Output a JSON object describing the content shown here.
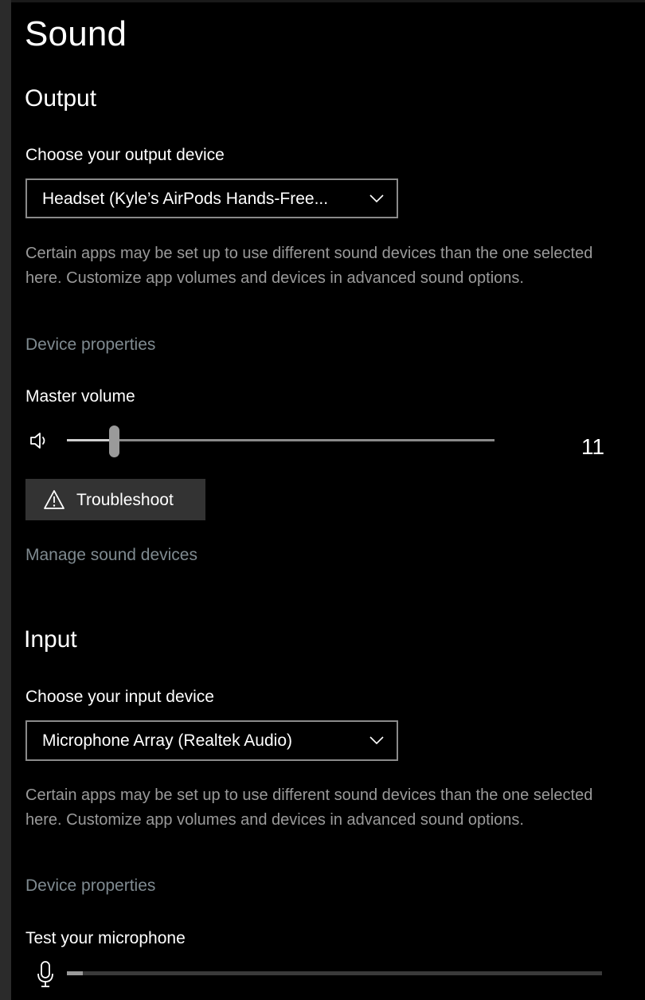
{
  "page": {
    "title": "Sound"
  },
  "output": {
    "title": "Output",
    "device_label": "Choose your output device",
    "selected_device": "Headset (Kyle’s AirPods Hands-Free...",
    "description": "Certain apps may be set up to use different sound devices than the one selected here. Customize app volumes and devices in advanced sound options.",
    "device_properties_link": "Device properties",
    "master_volume_label": "Master volume",
    "master_volume_value": "11",
    "master_volume_level": 11,
    "troubleshoot_label": "Troubleshoot",
    "manage_devices_link": "Manage sound devices"
  },
  "input": {
    "title": "Input",
    "device_label": "Choose your input device",
    "selected_device": "Microphone Array (Realtek Audio)",
    "description": "Certain apps may be set up to use different sound devices than the one selected here. Customize app volumes and devices in advanced sound options.",
    "device_properties_link": "Device properties",
    "test_label": "Test your microphone",
    "mic_level": 3
  },
  "icons": {
    "chevron": "chevron-down-icon",
    "speaker": "speaker-icon",
    "warning": "warning-icon",
    "microphone": "microphone-icon"
  },
  "colors": {
    "background": "#000000",
    "link": "#7f8a90",
    "secondary_text": "#9a9a9a",
    "button": "#333333"
  }
}
